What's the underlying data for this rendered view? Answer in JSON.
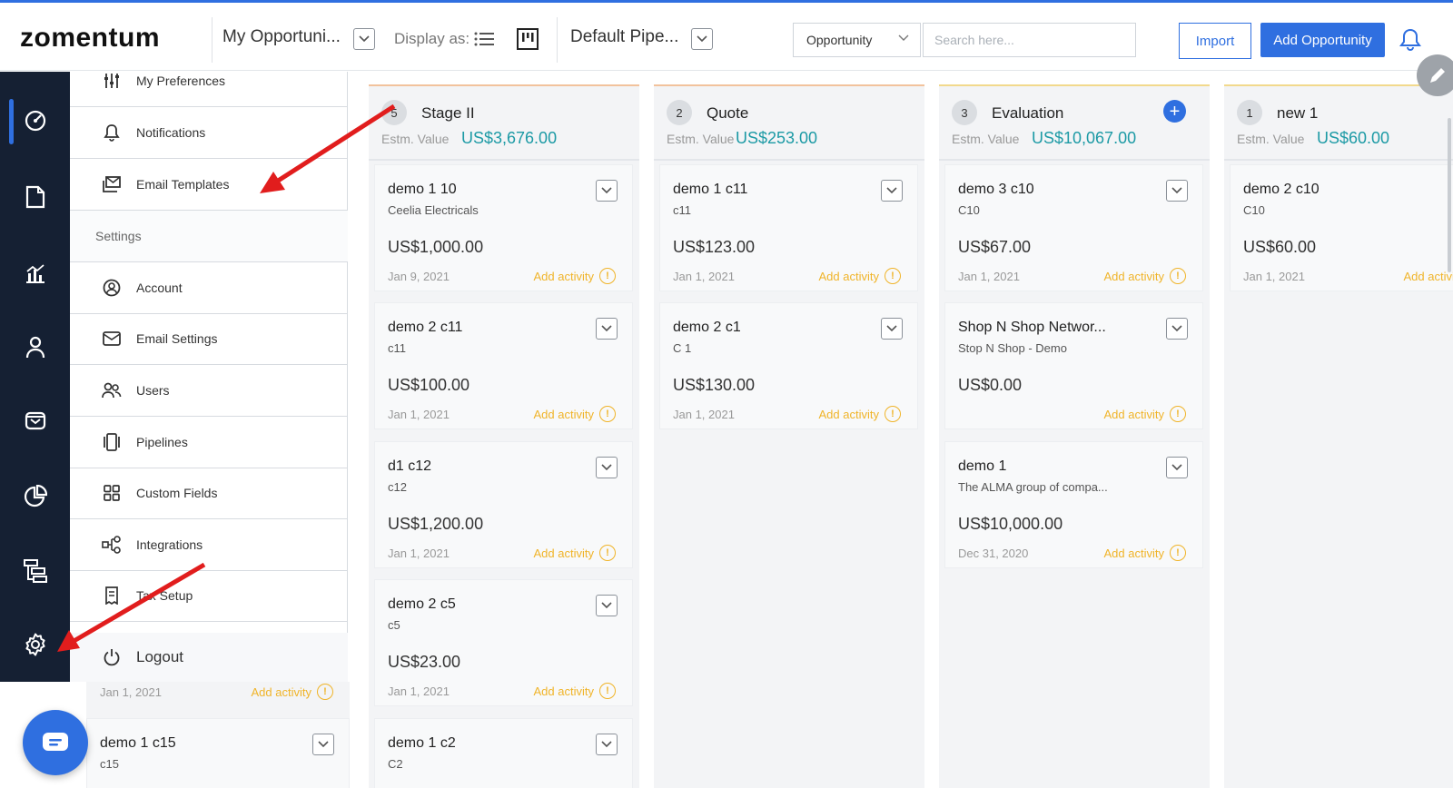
{
  "header": {
    "logo": "zomentum",
    "view_dropdown": "My Opportuni...",
    "display_as_label": "Display as:",
    "pipeline_dropdown": "Default Pipe...",
    "entity_select": "Opportunity",
    "search_placeholder": "Search here...",
    "import_label": "Import",
    "add_label": "Add Opportunity"
  },
  "leftnav": {
    "items": [
      "dashboard-icon",
      "document-icon",
      "reports-icon",
      "person-icon",
      "inbox-icon",
      "pie-chart-icon",
      "hierarchy-icon",
      "settings-icon"
    ],
    "active_index": 0
  },
  "settings_menu": {
    "items_top": [
      {
        "label": "My Preferences",
        "icon": "sliders-icon"
      },
      {
        "label": "Notifications",
        "icon": "bell-icon"
      },
      {
        "label": "Email Templates",
        "icon": "email-template-icon"
      }
    ],
    "section_label": "Settings",
    "items": [
      {
        "label": "Account",
        "icon": "account-icon"
      },
      {
        "label": "Email Settings",
        "icon": "mail-icon"
      },
      {
        "label": "Users",
        "icon": "users-icon"
      },
      {
        "label": "Pipelines",
        "icon": "pipelines-icon"
      },
      {
        "label": "Custom Fields",
        "icon": "grid-icon"
      },
      {
        "label": "Integrations",
        "icon": "integrations-icon"
      },
      {
        "label": "Tax Setup",
        "icon": "receipt-icon"
      }
    ],
    "logout_label": "Logout"
  },
  "board": {
    "estm_label": "Estm. Value",
    "add_activity_label": "Add activity",
    "columns": [
      {
        "count": "5",
        "title": "Stage II",
        "value": "US$3,676.00",
        "cards": [
          {
            "title": "demo 1 10",
            "sub": "Ceelia Electricals",
            "amount": "US$1,000.00",
            "date": "Jan 9, 2021"
          },
          {
            "title": "demo 2 c11",
            "sub": "c11",
            "amount": "US$100.00",
            "date": "Jan 1, 2021"
          },
          {
            "title": "d1 c12",
            "sub": "c12",
            "amount": "US$1,200.00",
            "date": "Jan 1, 2021"
          },
          {
            "title": "demo 2 c5",
            "sub": "c5",
            "amount": "US$23.00",
            "date": "Jan 1, 2021"
          },
          {
            "title": "demo 1 c2",
            "sub": "C2",
            "amount": "",
            "date": ""
          }
        ]
      },
      {
        "count": "2",
        "title": "Quote",
        "value": "US$253.00",
        "cards": [
          {
            "title": "demo 1 c11",
            "sub": "c11",
            "amount": "US$123.00",
            "date": "Jan 1, 2021"
          },
          {
            "title": "demo 2 c1",
            "sub": "C 1",
            "amount": "US$130.00",
            "date": "Jan 1, 2021"
          }
        ]
      },
      {
        "count": "3",
        "title": "Evaluation",
        "value": "US$10,067.00",
        "cards": [
          {
            "title": "demo 3 c10",
            "sub": "C10",
            "amount": "US$67.00",
            "date": "Jan 1, 2021"
          },
          {
            "title": "Shop N Shop Networ...",
            "sub": "Stop N Shop - Demo",
            "amount": "US$0.00",
            "date": ""
          },
          {
            "title": "demo 1",
            "sub": "The ALMA group of compa...",
            "amount": "US$10,000.00",
            "date": "Dec 31, 2020"
          }
        ]
      },
      {
        "count": "1",
        "title": "new 1",
        "value": "US$60.00",
        "cards": [
          {
            "title": "demo 2 c10",
            "sub": "C10",
            "amount": "US$60.00",
            "date": "Jan 1, 2021"
          }
        ]
      }
    ],
    "hidden_column_card": {
      "date": "Jan 1, 2021",
      "title": "demo 1 c15",
      "sub": "c15"
    }
  },
  "colors": {
    "accent": "#2f6fe0",
    "nav_bg": "#152033",
    "value_teal": "#1c9aa5",
    "activity": "#f0b429",
    "arrow": "#e11d1d"
  }
}
